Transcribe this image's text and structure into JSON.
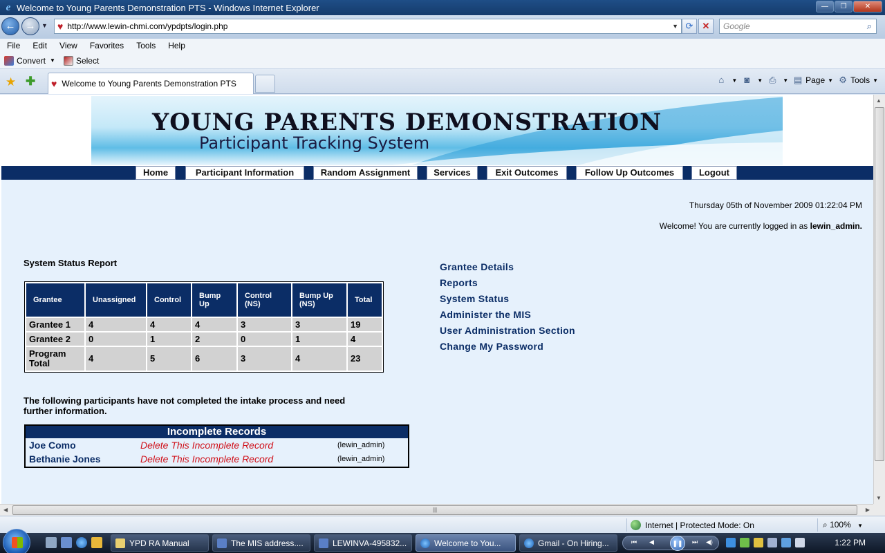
{
  "window": {
    "title": "Welcome to Young Parents Demonstration PTS - Windows Internet Explorer",
    "buttons": {
      "minimize": "—",
      "maximize": "❐",
      "close": "✕"
    }
  },
  "address_bar": {
    "url": "http://www.lewin-chmi.com/ypdpts/login.php",
    "search_placeholder": "Google"
  },
  "menu": [
    "File",
    "Edit",
    "View",
    "Favorites",
    "Tools",
    "Help"
  ],
  "command_bar": {
    "convert_label": "Convert",
    "select_label": "Select"
  },
  "tab": {
    "title": "Welcome to Young Parents Demonstration PTS"
  },
  "toolbar_right": {
    "page_label": "Page",
    "tools_label": "Tools"
  },
  "banner": {
    "title": "YOUNG PARENTS DEMONSTRATION",
    "subtitle": "Participant Tracking System"
  },
  "nav": [
    "Home",
    "Participant Information",
    "Random Assignment",
    "Services",
    "Exit Outcomes",
    "Follow Up Outcomes",
    "Logout"
  ],
  "datetime": "Thursday 05th of November 2009 01:22:04 PM",
  "welcome": {
    "prefix": "Welcome! You are currently logged in as ",
    "user": "lewin_admin."
  },
  "status_report": {
    "title": "System Status Report",
    "headers": [
      "Grantee",
      "Unassigned",
      "Control",
      "Bump Up",
      "Control (NS)",
      "Bump Up (NS)",
      "Total"
    ],
    "rows": [
      [
        "Grantee 1",
        "4",
        "4",
        "4",
        "3",
        "3",
        "19"
      ],
      [
        "Grantee 2",
        "0",
        "1",
        "2",
        "0",
        "1",
        "4"
      ],
      [
        "Program Total",
        "4",
        "5",
        "6",
        "3",
        "4",
        "23"
      ]
    ]
  },
  "incomplete": {
    "note": "The following participants have not completed the intake process and need further information.",
    "header": "Incomplete Records",
    "rows": [
      {
        "name": "Joe Como",
        "action": "Delete This Incomplete Record",
        "user": "(lewin_admin)"
      },
      {
        "name": "Bethanie Jones",
        "action": "Delete This Incomplete Record",
        "user": "(lewin_admin)"
      }
    ]
  },
  "side_links": [
    "Grantee Details",
    "Reports",
    "System Status",
    "Administer the MIS",
    "User Administration Section",
    "Change My Password"
  ],
  "statusbar": {
    "zone": "Internet | Protected Mode: On",
    "zoom": "100%"
  },
  "taskbar": {
    "tasks": [
      "YPD RA Manual",
      "The MIS address....",
      "LEWINVA-495832...",
      "Welcome to You...",
      "Gmail - On Hiring..."
    ],
    "clock": "1:22 PM"
  }
}
